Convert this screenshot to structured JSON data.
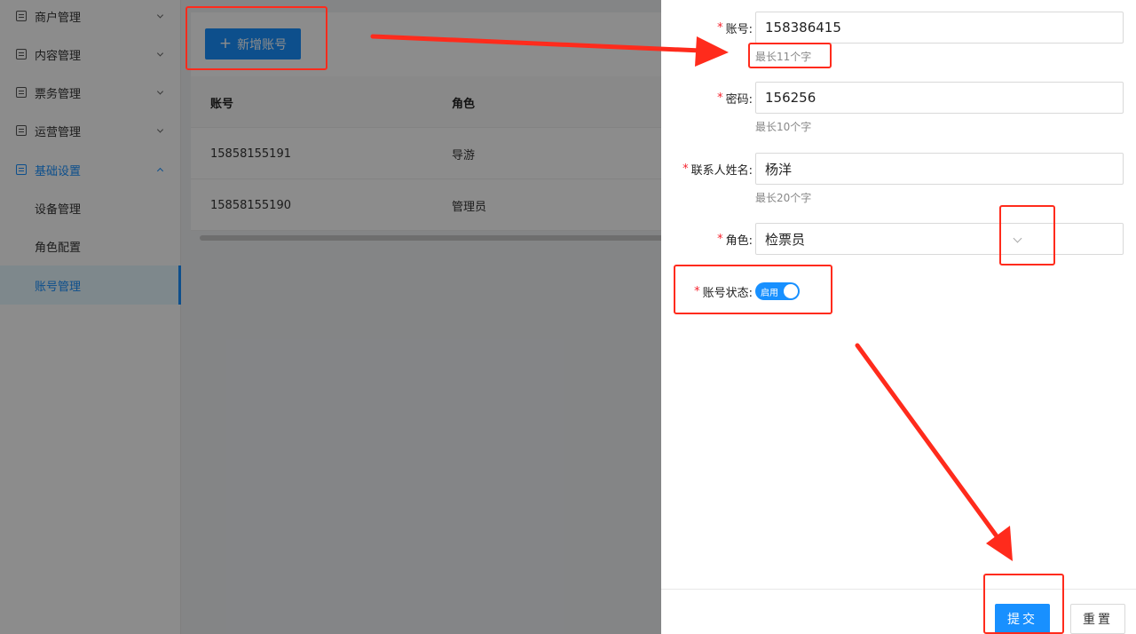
{
  "sidebar": {
    "items": [
      {
        "label": "商户管理",
        "icon": "list-icon"
      },
      {
        "label": "内容管理",
        "icon": "list-icon"
      },
      {
        "label": "票务管理",
        "icon": "copy-icon"
      },
      {
        "label": "运营管理",
        "icon": "list-icon"
      },
      {
        "label": "基础设置",
        "icon": "grid-icon",
        "expanded": true
      }
    ],
    "sub_items": [
      {
        "label": "设备管理"
      },
      {
        "label": "角色配置"
      },
      {
        "label": "账号管理",
        "selected": true
      }
    ]
  },
  "main": {
    "add_button_label": "新增账号",
    "table": {
      "headers": [
        "账号",
        "角色"
      ],
      "rows": [
        [
          "15858155191",
          "导游"
        ],
        [
          "15858155190",
          "管理员"
        ]
      ]
    }
  },
  "drawer": {
    "account": {
      "label": "账号:",
      "value": "158386415",
      "help": "最长11个字"
    },
    "password": {
      "label": "密码:",
      "value": "156256",
      "help": "最长10个字"
    },
    "contact": {
      "label": "联系人姓名:",
      "value": "杨洋",
      "help": "最长20个字"
    },
    "role": {
      "label": "角色:",
      "value": "检票员"
    },
    "status": {
      "label": "账号状态:",
      "switch_text": "启用",
      "on": true
    },
    "submit_label": "提交",
    "reset_label": "重置"
  },
  "colors": {
    "primary": "#1890ff",
    "annotation": "#ff2b1c",
    "required": "#f5222d"
  }
}
